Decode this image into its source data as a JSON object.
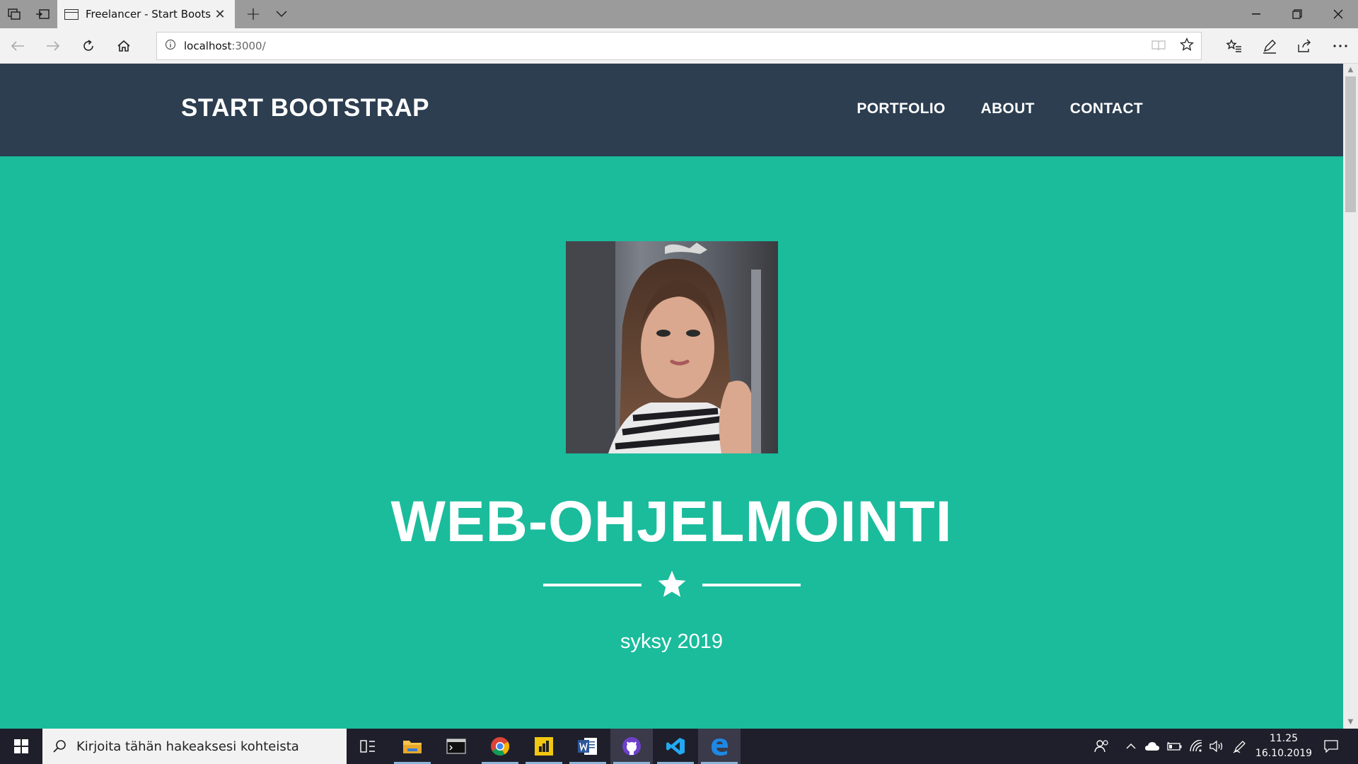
{
  "browser": {
    "tab": {
      "title": "Freelancer - Start Boots"
    },
    "url": {
      "host": "localhost",
      "path": ":3000/"
    }
  },
  "site": {
    "brand": "START BOOTSTRAP",
    "nav": [
      {
        "label": "PORTFOLIO"
      },
      {
        "label": "ABOUT"
      },
      {
        "label": "CONTACT"
      }
    ],
    "masthead": {
      "heading": "WEB-OHJELMOINTI",
      "subheading": "syksy 2019"
    }
  },
  "taskbar": {
    "search_placeholder": "Kirjoita tähän hakeaksesi kohteista",
    "clock": {
      "time": "11.25",
      "date": "16.10.2019"
    }
  },
  "colors": {
    "navbar": "#2c3e50",
    "masthead": "#1abc9c",
    "taskbar": "#1f1f2b"
  }
}
